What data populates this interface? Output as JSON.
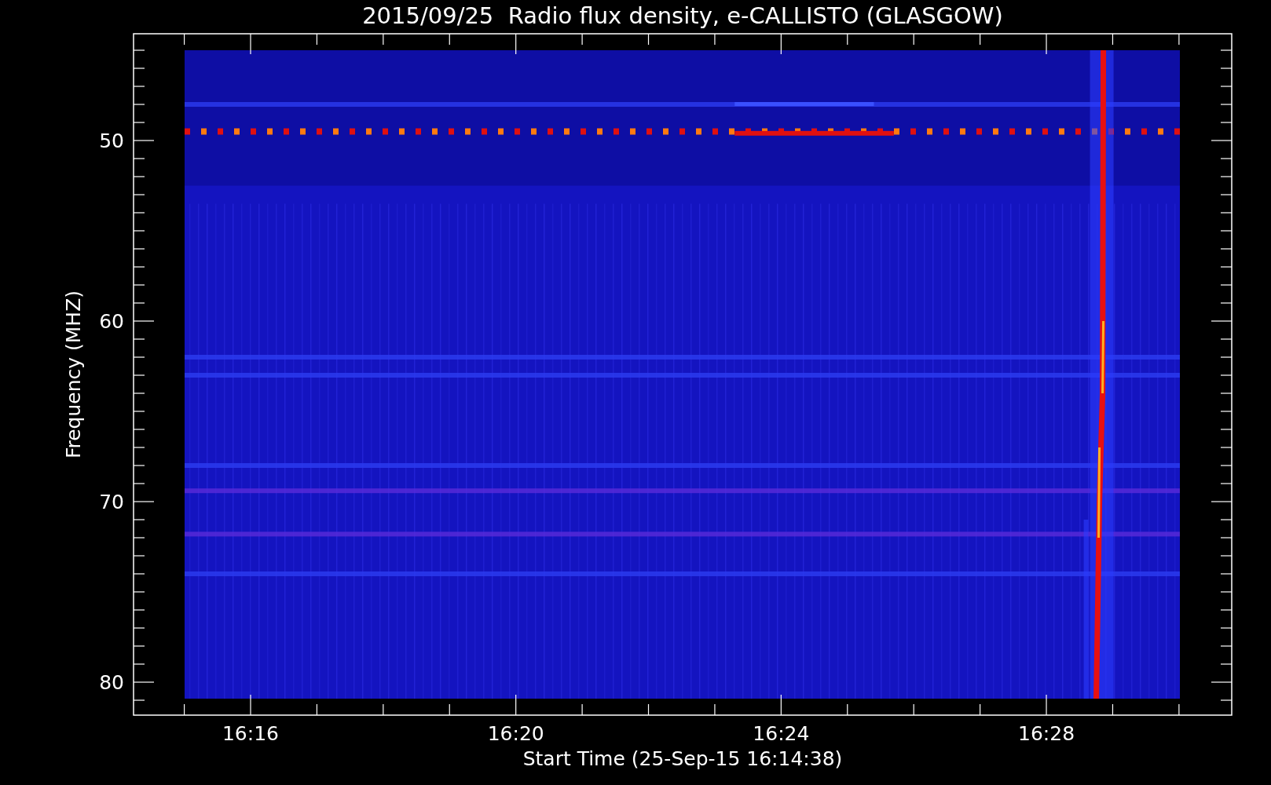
{
  "title": "2015/09/25  Radio flux density, e-CALLISTO (GLASGOW)",
  "y_axis": {
    "label": "Frequency (MHZ)",
    "ticks": [
      "50",
      "60",
      "70",
      "80"
    ]
  },
  "x_axis": {
    "label": "Start Time (25-Sep-15 16:14:38)",
    "ticks": [
      "16:16",
      "16:20",
      "16:24",
      "16:28"
    ]
  }
}
